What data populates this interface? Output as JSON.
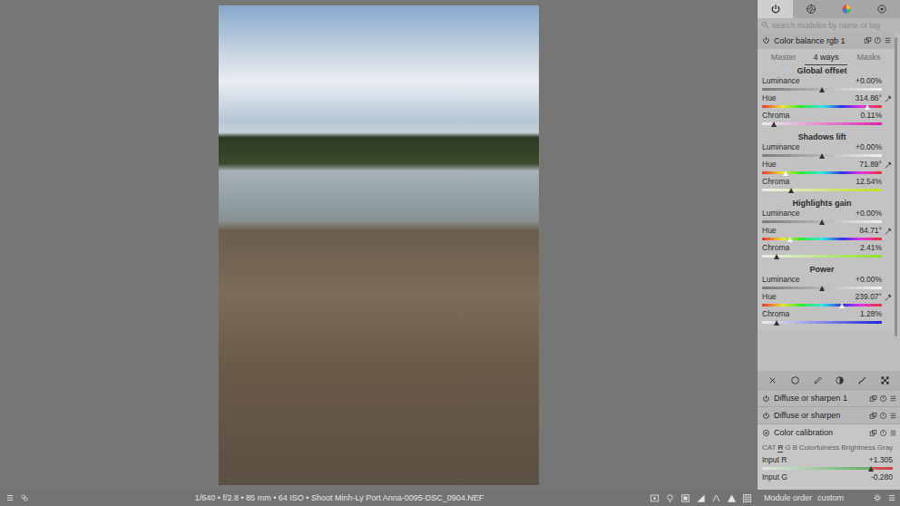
{
  "panel_tabs": [
    {
      "selected": true
    },
    {
      "selected": false
    },
    {
      "selected": false
    },
    {
      "selected": false
    }
  ],
  "search": {
    "placeholder": "search modules by name or tag"
  },
  "module": {
    "title": "Color balance rgb 1",
    "enabled": true,
    "tabs": [
      {
        "label": "Master",
        "selected": false
      },
      {
        "label": "4 ways",
        "selected": true
      },
      {
        "label": "Masks",
        "selected": false
      }
    ],
    "sections": [
      {
        "title": "Global offset",
        "sliders": [
          {
            "kind": "luminance",
            "label": "Luminance",
            "value": "+0.00%",
            "level": 0.5
          },
          {
            "kind": "hue",
            "label": "Hue",
            "value": "314.86°",
            "level": 0.875
          },
          {
            "kind": "chroma",
            "label": "Chroma",
            "value": "0.11%",
            "level": 0.1
          }
        ]
      },
      {
        "title": "Shadows lift",
        "sliders": [
          {
            "kind": "luminance",
            "label": "Luminance",
            "value": "+0.00%",
            "level": 0.5
          },
          {
            "kind": "hue",
            "label": "Hue",
            "value": "71.89°",
            "level": 0.2
          },
          {
            "kind": "chroma",
            "label": "Chroma",
            "value": "12.54%",
            "level": 0.24
          }
        ]
      },
      {
        "title": "Highlights gain",
        "sliders": [
          {
            "kind": "luminance",
            "label": "Luminance",
            "value": "+0.00%",
            "level": 0.5
          },
          {
            "kind": "hue",
            "label": "Hue",
            "value": "84.71°",
            "level": 0.235
          },
          {
            "kind": "chroma",
            "label": "Chroma",
            "value": "2.41%",
            "level": 0.12
          }
        ]
      },
      {
        "title": "Power",
        "sliders": [
          {
            "kind": "luminance",
            "label": "Luminance",
            "value": "+0.00%",
            "level": 0.5
          },
          {
            "kind": "hue",
            "label": "Hue",
            "value": "239.07°",
            "level": 0.664
          },
          {
            "kind": "chroma",
            "label": "Chroma",
            "value": "1.28%",
            "level": 0.12
          }
        ]
      }
    ]
  },
  "modules": [
    {
      "title": "Diffuse or sharpen 1",
      "enabled": true,
      "expanded": false
    },
    {
      "title": "Diffuse or sharpen",
      "enabled": true,
      "expanded": false
    },
    {
      "title": "Color calibration",
      "enabled": true,
      "expanded": true,
      "tabs": [
        {
          "label": "CAT",
          "selected": false
        },
        {
          "label": "R",
          "selected": true
        },
        {
          "label": "G",
          "selected": false
        },
        {
          "label": "B",
          "selected": false
        },
        {
          "label": "Colorfulness",
          "selected": false
        },
        {
          "label": "Brightness",
          "selected": false
        },
        {
          "label": "Gray",
          "selected": false
        }
      ],
      "sliders": [
        {
          "kind": "channel",
          "label": "Input R",
          "value": "+1.305",
          "level": 0.83
        },
        {
          "kind": "channel",
          "label": "Input G",
          "value": "-0.280"
        }
      ]
    }
  ],
  "status_bar": {
    "info": "1/640 • f/2.8 • 85 mm • 64 ISO • Shoot Minh-Ly Port Anna-0095-DSC_0904.NEF",
    "module_order_label": "Module order",
    "module_order_value": "custom"
  }
}
